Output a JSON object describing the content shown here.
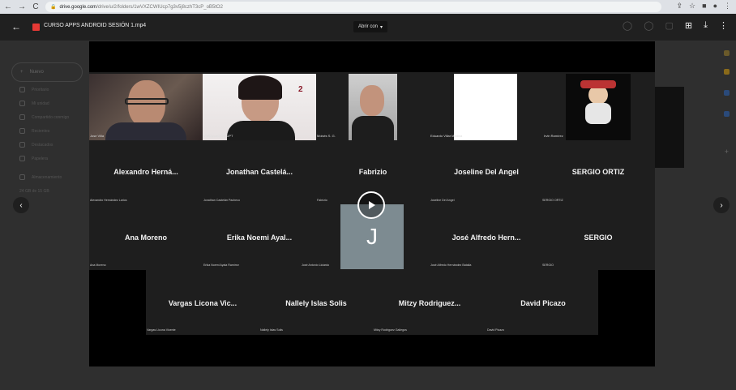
{
  "browser": {
    "url_host": "drive.google.com",
    "url_path": "/drive/u/2/folders/1wVXZCWIUcp7g3v5j8czhT3cP_oB5tO2"
  },
  "viewer": {
    "file_title": "CURSO APPS ANDROID SESIÓN 1.mp4",
    "open_with_label": "Abrir con"
  },
  "colors": {
    "file_icon": "#e53935",
    "avatar_j": "#7d8b91",
    "tile_white": "#ffffff"
  },
  "video_tiles": {
    "camera_row": [
      {
        "label": "Jose Villa",
        "icon": "man-with-headset-photo"
      },
      {
        "label": "VINCULACIÓN UPT",
        "icon": "woman-glasses-photo"
      },
      {
        "label": "Moisés S. G.",
        "icon": "man-glasses-photo"
      },
      {
        "label": "Eduardo Villar Medina",
        "icon": "blank-white-video"
      },
      {
        "label": "Irvin Ramírez",
        "icon": "cartoon-avatar"
      }
    ],
    "name_rows": [
      [
        {
          "big": "Alexandro Herná...",
          "small": "Alexandro Hernández Larios"
        },
        {
          "big": "Jonathan Castelá...",
          "small": "Jonathan Castelán Pacheco"
        },
        {
          "big": "Fabrizio",
          "small": "Fabrizio"
        },
        {
          "big": "Joseline Del Angel",
          "small": "Joseline Del Angel"
        },
        {
          "big": "SERGIO ORTIZ",
          "small": "SERGIO ORTIZ"
        }
      ],
      [
        {
          "big": "Ana Moreno",
          "small": "Ana Moreno"
        },
        {
          "big": "Erika Noemi Ayal...",
          "small": "Erika Noemi Ayala Ramírez"
        },
        {
          "big": "",
          "small": "José Antonio Liciardo"
        },
        {
          "big": "José Alfredo Hern...",
          "small": "José Alfredo Hernández Batalla"
        },
        {
          "big": "SERGIO",
          "small": "SERGIO"
        }
      ],
      [
        {
          "big": "Vargas Licona Vic...",
          "small": "Vargas Licona Vicente"
        },
        {
          "big": "Nallely Islas Solis",
          "small": "Nallely Islas Solis"
        },
        {
          "big": "Mitzy Rodriguez...",
          "small": "Mitzy Rodriguez Gallegos"
        },
        {
          "big": "David Picazo",
          "small": "David Picazo"
        }
      ]
    ],
    "avatar_letter": "J"
  },
  "drive_sidebar": {
    "new_label": "Nuevo",
    "items": [
      "Prioritario",
      "Mi unidad",
      "Compartido conmigo",
      "Recientes",
      "Destacados",
      "Papelera",
      "Almacenamiento",
      "24 GB de 15 GB"
    ]
  }
}
